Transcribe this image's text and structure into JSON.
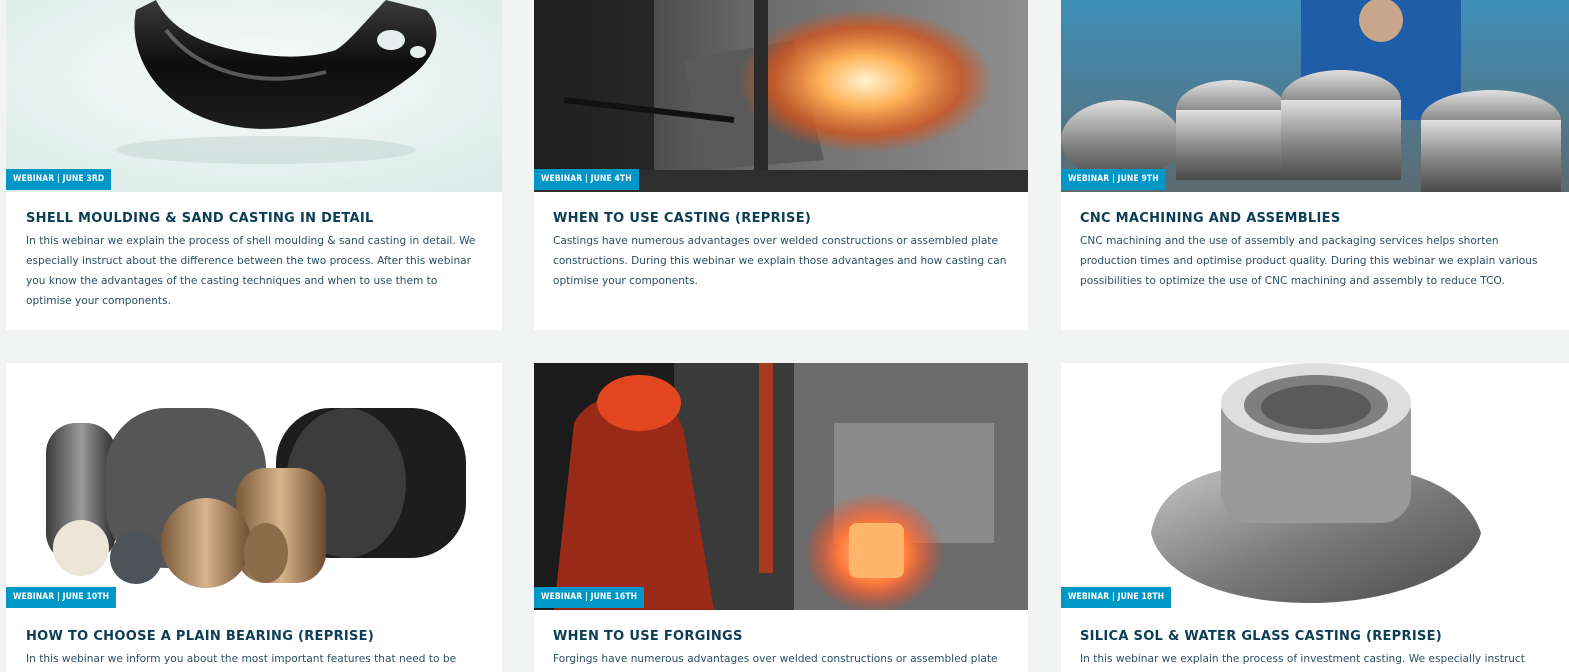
{
  "cards": [
    {
      "badge": "WEBINAR | JUNE 3RD",
      "title": "SHELL MOULDING & SAND CASTING IN DETAIL",
      "description": "In this webinar we explain the process of shell moulding & sand casting in detail. We especially instruct about the difference between the two process. After this webinar you know the advantages of the casting techniques and when to use them to optimise your components.",
      "image": "black-cast-part-photo"
    },
    {
      "badge": "WEBINAR | JUNE 4TH",
      "title": "WHEN TO USE CASTING (REPRISE)",
      "description": "Castings have numerous advantages over welded constructions or assembled plate constructions. During this webinar we explain those advantages and how casting can optimise your components.",
      "image": "foundry-pouring-photo"
    },
    {
      "badge": "WEBINAR | JUNE 9TH",
      "title": "CNC MACHINING AND ASSEMBLIES",
      "description": "CNC machining and the use of assembly and packaging services helps shorten production times and optimise product quality. During this webinar we explain various possibilities to optimize the use of CNC machining and assembly to reduce TCO.",
      "image": "cnc-assembly-photo"
    },
    {
      "badge": "WEBINAR | JUNE 10TH",
      "title": "HOW TO CHOOSE A PLAIN BEARING (REPRISE)",
      "description": "In this webinar we inform you about the most important features that need to be your",
      "image": "plain-bearings-photo"
    },
    {
      "badge": "WEBINAR | JUNE 16TH",
      "title": "WHEN TO USE FORGINGS",
      "description": "Forgings have numerous advantages over welded constructions or assembled plate",
      "image": "forging-worker-photo"
    },
    {
      "badge": "WEBINAR | JUNE 18TH",
      "title": "SILICA SOL & WATER GLASS CASTING (REPRISE)",
      "description": "In this webinar we explain the process of investment casting. We especially instruct",
      "image": "investment-cast-part-photo"
    }
  ],
  "colors": {
    "page_bg": "#f2f3f3",
    "badge": "#0097c6",
    "title": "#0b3d55",
    "text": "#2b4f63"
  }
}
